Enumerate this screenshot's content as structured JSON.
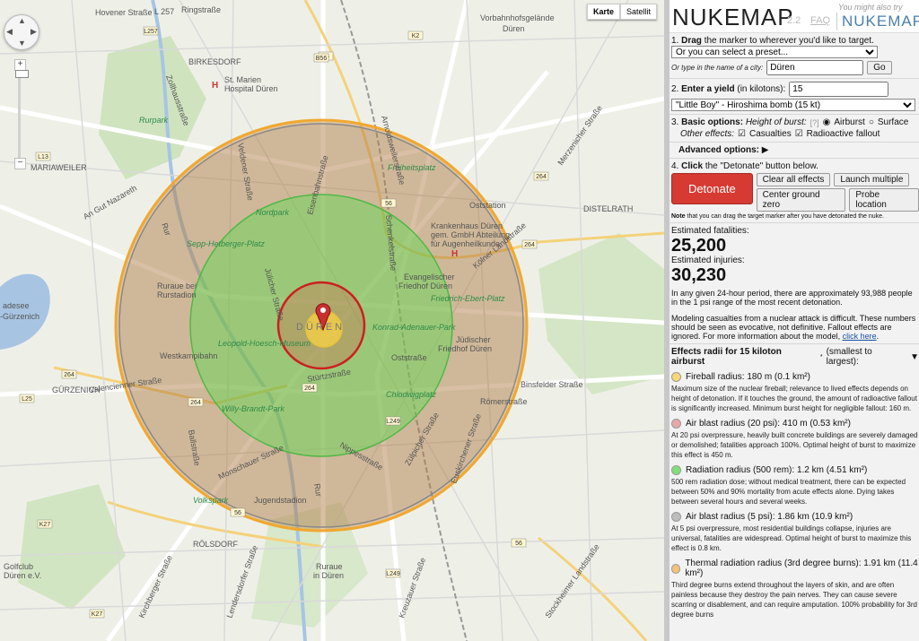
{
  "map": {
    "type_buttons": [
      "Karte",
      "Satellit"
    ],
    "labels": {
      "hovener": "Hovener Straße",
      "l257": "L 257",
      "ringstrasse": "Ringstraße",
      "vorbahnhof": "Vorbahnhofsgelände",
      "dueren_n": "Düren",
      "birkesdorf": "BIRKESDORF",
      "marien": "St. Marien",
      "hospital": "Hospital Düren",
      "rurpark": "Rurpark",
      "mariaweiler": "MARIAWEILER",
      "an_gut": "An Gut Nazareth",
      "freiheitsplatz": "Freiheitsplatz",
      "nordpark": "Nordpark",
      "oststation": "Oststation",
      "distelrath": "DISTELRATH",
      "krankenhaus1": "Krankenhaus Düren",
      "krankenhaus2": "gem. GmbH Abteilung",
      "krankenhaus3": "für Augenheilkunde",
      "sepp": "Sepp-Hetberger-Platz",
      "ev1": "Evangelischer",
      "ev2": "Friedhof Düren",
      "friedrich": "Friedrich-Ebert-Platz",
      "ruraue1": "Ruraue bei",
      "ruraue2": "Rurstadion",
      "dueren_c": "DÜREN",
      "leopold": "Leopold-Hoesch-Museum",
      "konrad": "Konrad-Adenauer-Park",
      "juedischer1": "Jüdischer",
      "juedischer2": "Friedhof Düren",
      "westkampibahn": "Westkampibahn",
      "ostrasse": "Oststraße",
      "chlodwig": "Chlodwigplatz",
      "guerzenich": "GÜRZENICH",
      "stuertz": "Stürtzstraße",
      "valencienner": "Valencienner Straße",
      "binsfelder": "Binsfelder Straße",
      "willy": "Willy-Brandt-Park",
      "roemer": "Römerstraße",
      "adesee1": "adesee",
      "adesee2": "-Gürzenich",
      "jugendstadion": "Jugendstadion",
      "volkspark": "Volkspark",
      "ruraue3": "Ruraue",
      "ruraue4": "in Düren",
      "roelsdorf": "RÖLSDORF",
      "golfclub1": "Golfclub",
      "golfclub2": "Düren e.V.",
      "stockheimer": "Stockheimer Landstraße",
      "monschauer": "Monschauer Straße",
      "nippes": "Nippesstraße",
      "koelner": "Kölner Landstraße",
      "zollhaus": "Zollhausstraße",
      "veldener": "Veldener Straße",
      "arnoldsweiler": "Arnoldsweilerstraße",
      "schenkel": "Schenkelstraße",
      "merzenicher": "Merzenicher Straße",
      "eisenbahn": "Eisenbahnstraße",
      "euskirchener": "Euskirchener Straße",
      "zuelpicher": "Zülpicher Straße",
      "kreuzauer": "Kreuzauer Straße",
      "lendersdorfer": "Lendersdorfer Straße",
      "badenstrasse": "Ballstraße",
      "rur": "Rur",
      "rur2": "Rur",
      "jupiterbad": "Jülicher Straße",
      "kirch": "Kirchberger Straße"
    },
    "road_numbers": [
      "56",
      "264",
      "264",
      "264",
      "56",
      "264",
      "264",
      "56",
      "56",
      "K2",
      "L13",
      "L25",
      "K27",
      "L249",
      "L249",
      "K27",
      "L257",
      "B56"
    ]
  },
  "panel": {
    "title": "NUKEMAP",
    "version": "2.2",
    "faq": "FAQ",
    "also_try": "You might also try",
    "nukemap3d": "NUKEMAP3D",
    "step1_num": "1.",
    "step1_bold": "Drag",
    "step1_rest": "the marker to wherever you'd like to target.",
    "preset_selected": "Or you can select a preset...",
    "city_hint": "Or type in the name of a city:",
    "city_value": "Düren",
    "go_label": "Go",
    "step2_num": "2.",
    "step2_bold": "Enter a yield",
    "step2_rest": "(in kilotons):",
    "yield_value": "15",
    "bomb_selected": "\"Little Boy\" - Hiroshima bomb (15 kt)",
    "step3_num": "3.",
    "step3_bold": "Basic options:",
    "height_label": "Height of burst:",
    "height_help": "[?]",
    "airburst_label": "Airburst",
    "surface_label": "Surface",
    "other_label": "Other effects:",
    "casualties_label": "Casualties",
    "fallout_label": "Radioactive fallout",
    "advanced_label": "Advanced options:",
    "step4_num": "4.",
    "step4_bold": "Click",
    "step4_rest": "the \"Detonate\" button below.",
    "detonate_label": "Detonate",
    "clear_label": "Clear all effects",
    "launch_label": "Launch multiple",
    "center_label": "Center ground zero",
    "probe_label": "Probe location",
    "note_bold": "Note",
    "note_rest": "that you can drag the target marker after you have detonated the nuke.",
    "fatalities_label": "Estimated fatalities:",
    "fatalities_value": "25,200",
    "injuries_label": "Estimated injuries:",
    "injuries_value": "30,230",
    "period_text": "In any given 24-hour period, there are approximately 93,988 people in the 1 psi range of the most recent detonation.",
    "model_text": "Modeling casualties from a nuclear attack is difficult. These numbers should be seen as evocative, not definitive. Fallout effects are ignored. For more information about the model,",
    "click_here": "click here",
    "effects_head": "Effects radii for 15 kiloton airburst",
    "effects_sup": "*",
    "effects_order": "(smallest to largest):",
    "effects": [
      {
        "color": "#f7d774",
        "title": "Fireball radius: 180 m (0.1 km²)",
        "desc": "Maximum size of the nuclear fireball; relevance to lived effects depends on height of detonation. If it touches the ground, the amount of radioactive fallout is significantly increased. Minimum burst height for negligible fallout: 160 m."
      },
      {
        "color": "#e8a8a8",
        "title": "Air blast radius (20 psi): 410 m (0.53 km²)",
        "desc": "At 20 psi overpressure, heavily built concrete buildings are severely damaged or demolished; fatalities approach 100%. Optimal height of burst to maximize this effect is 450 m."
      },
      {
        "color": "#7ee07a",
        "title": "Radiation radius (500 rem): 1.2 km (4.51 km²)",
        "desc": "500 rem radiation dose; without medical treatment, there can be expected between 50% and 90% mortality from acute effects alone. Dying takes between several hours and several weeks."
      },
      {
        "color": "#bdbdbd",
        "title": "Air blast radius (5 psi): 1.86 km (10.9 km²)",
        "desc": "At 5 psi overpressure, most residential buildings collapse, injuries are universal, fatalities are widespread. Optimal height of burst to maximize this effect is 0.8 km."
      },
      {
        "color": "#f5c27a",
        "title": "Thermal radiation radius (3rd degree burns): 1.91 km (11.4 km²)",
        "desc": "Third degree burns extend throughout the layers of skin, and are often painless because they destroy the pain nerves. They can cause severe scarring or disablement, and can require amputation. 100% probability for 3rd degree burns"
      }
    ]
  }
}
